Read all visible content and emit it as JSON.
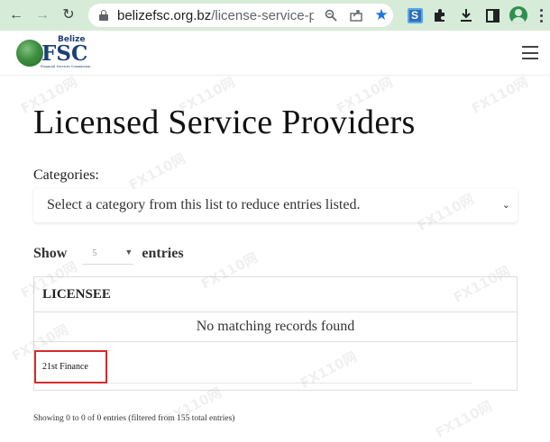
{
  "browser": {
    "url_host": "belizefsc.org.bz",
    "url_path": "/license-service-p...",
    "back_icon": "arrow-left",
    "forward_icon": "arrow-right",
    "reload_icon": "reload",
    "extension_label": "S"
  },
  "site": {
    "logo_word": "FSC",
    "logo_country": "Belize",
    "logo_tagline": "Financial Services Commission"
  },
  "page": {
    "title": "Licensed Service Providers",
    "categories_label": "Categories:",
    "category_placeholder": "Select a category from this list to reduce entries listed.",
    "show_label": "Show",
    "length_value": "5",
    "entries_label": "entries"
  },
  "table": {
    "columns": [
      "LICENSEE"
    ],
    "empty_message": "No matching records found",
    "footer_filter_value": "21st Finance",
    "info": "Showing 0 to 0 of 0 entries (filtered from 155 total entries)"
  },
  "watermark": "FX110网",
  "colors": {
    "chrome_bg": "#d7ebd9",
    "brand_blue": "#1e3f76",
    "highlight_red": "#d62b2b",
    "star_blue": "#1a73e8"
  }
}
